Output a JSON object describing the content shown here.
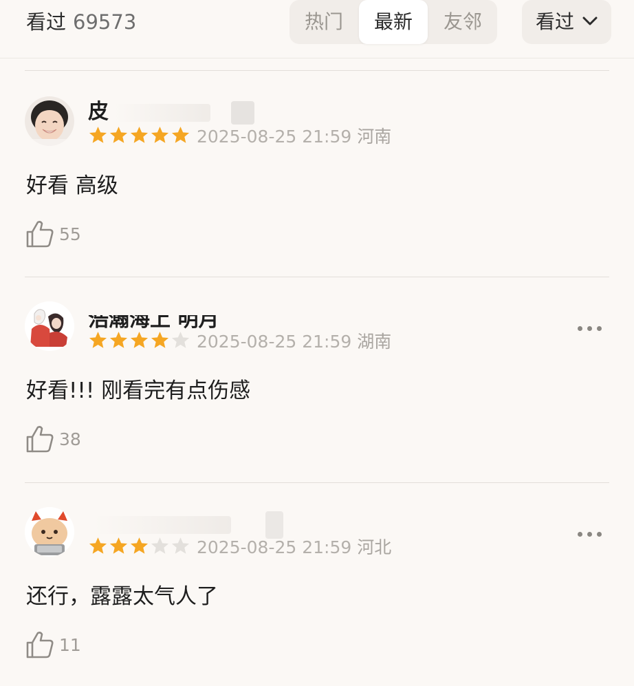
{
  "header": {
    "section_label": "看过",
    "count": "69573",
    "tabs": [
      {
        "label": "热门",
        "active": false
      },
      {
        "label": "最新",
        "active": true
      },
      {
        "label": "友邻",
        "active": false
      }
    ],
    "filter": {
      "label": "看过",
      "icon": "chevron-down-icon"
    }
  },
  "colors": {
    "star_filled": "#f5a623",
    "star_empty": "#e3e0dc",
    "background": "#fbf8f5"
  },
  "reviews": [
    {
      "username": "皮",
      "rating": 5,
      "max_rating": 5,
      "date": "2025-08-25 21:59",
      "region": "河南",
      "content": "好看 高级",
      "likes": "55",
      "avatar": "boy-smiling-avatar",
      "has_more_menu": false
    },
    {
      "username": "浩瀚海上 明月",
      "rating": 4,
      "max_rating": 5,
      "date": "2025-08-25 21:59",
      "region": "湖南",
      "content": "好看!!! 刚看完有点伤感",
      "likes": "38",
      "avatar": "anime-characters-avatar",
      "has_more_menu": true
    },
    {
      "username": "",
      "rating": 3,
      "max_rating": 5,
      "date": "2025-08-25 21:59",
      "region": "河北",
      "content": "还行，露露太气人了",
      "likes": "11",
      "avatar": "cartoon-cat-avatar",
      "has_more_menu": true
    }
  ]
}
